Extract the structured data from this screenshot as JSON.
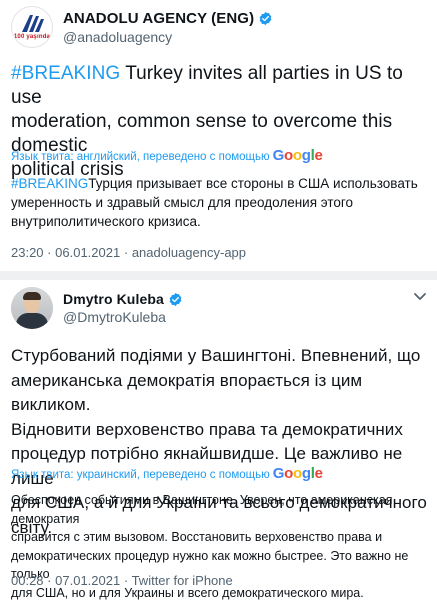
{
  "tweet1": {
    "display_name": "ANADOLU AGENCY (ENG)",
    "handle": "@anadoluagency",
    "avatar_logo_text": "100 yaşında",
    "hashtag": "#BREAKING",
    "text_line1_rest": " Turkey invites all parties in US to use",
    "text_line2": "moderation, common sense to overcome this domestic",
    "text_line3": "political crisis",
    "translate_label": "Язык твита: английский, переведено с помощью",
    "translate_provider": "Google",
    "translation_hashtag": "#BREAKING",
    "translation_line1_rest": "Турция призывает все стороны в США использовать",
    "translation_line2": "умеренность и здравый смысл для преодоления этого",
    "translation_line3": "внутриполитического кризиса.",
    "time": "23:20",
    "date": "06.01.2021",
    "source": "anadoluagency-app"
  },
  "tweet2": {
    "display_name": "Dmytro Kuleba",
    "handle": "@DmytroKuleba",
    "text_line1": "Стурбований подіями у Вашингтоні. Впевнений, що",
    "text_line2": "американська демократія впорається із цим викликом.",
    "text_line3": "Відновити верховенство права та демократичних",
    "text_line4": "процедур потрібно якнайшвидше. Це важливо не лише",
    "text_line5": "для США, а й для України та всього демократичного світу.",
    "translate_label": "Язык твита: украинский, переведено с помощью",
    "translate_provider": "Google",
    "translation_line1": "Обеспокоен событиями в Вашингтоне. Уверен, что американская демократия",
    "translation_line2": "справится с этим вызовом. Восстановить верховенство права и",
    "translation_line3": "демократических процедур нужно как можно быстрее. Это важно не только",
    "translation_line4": "для США, но и для Украины и всего демократического мира.",
    "time": "00:28",
    "date": "07.01.2021",
    "source": "Twitter for iPhone"
  },
  "meta_separator": "·",
  "colors": {
    "link_blue": "#1d9bf0",
    "text": "#0f1419",
    "secondary": "#536471",
    "separator": "#eef0f2",
    "aa_red": "#c4161c"
  },
  "icons": {
    "verified": "verified-badge-icon",
    "chevron": "chevron-down-icon"
  }
}
